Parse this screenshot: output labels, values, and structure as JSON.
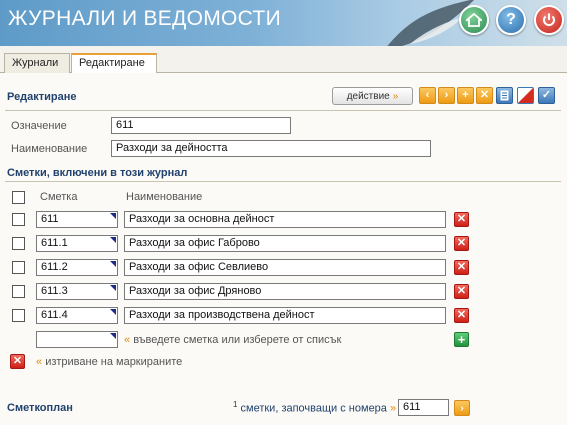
{
  "header": {
    "title": "ЖУРНАЛИ И ВЕДОМОСТИ"
  },
  "tabs": [
    {
      "label": "Журнали"
    },
    {
      "label": "Редактиране"
    }
  ],
  "editor": {
    "section_title": "Редактиране",
    "action_label": "действие",
    "action_arrow": "»",
    "designation_label": "Означение",
    "designation_value": "611",
    "name_label": "Наименование",
    "name_value": "Разходи за дейността"
  },
  "accounts": {
    "section_title": "Сметки, включени в този журнал",
    "col_account": "Сметка",
    "col_name": "Наименование",
    "rows": [
      {
        "account": "611",
        "name": "Разходи за основна дейност"
      },
      {
        "account": "611.1",
        "name": "Разходи за офис Габрово"
      },
      {
        "account": "611.2",
        "name": "Разходи за офис Севлиево"
      },
      {
        "account": "611.3",
        "name": "Разходи за офис Дряново"
      },
      {
        "account": "611.4",
        "name": "Разходи за производствена дейност"
      }
    ],
    "new_row_hint": "въведете сметка или изберете от списък",
    "delete_marked_label": "изтриване на маркираните",
    "hint_quote": "«"
  },
  "chart_of_accounts": {
    "section_title": "Сметкоплан",
    "footnote": "1",
    "prefix_label": "сметки, започващи с номера",
    "prefix_arrow": "»",
    "prefix_value": "611"
  },
  "colors": {
    "accent": "#21426e",
    "orange": "#ee9a14",
    "delete": "#cf1f16",
    "add": "#24923f"
  }
}
